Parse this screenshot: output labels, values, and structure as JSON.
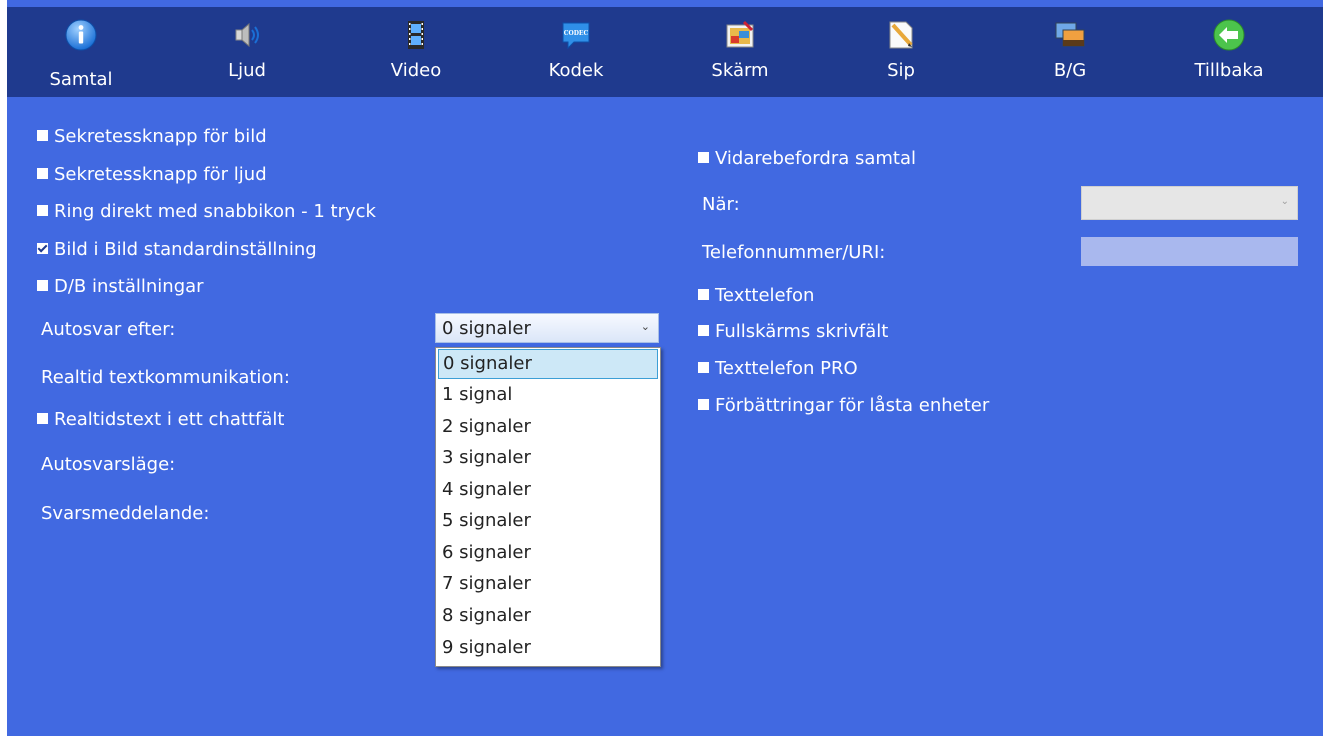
{
  "toolbar": {
    "items": [
      {
        "label": "Samtal",
        "icon": "info-icon"
      },
      {
        "label": "Ljud",
        "icon": "speaker-icon"
      },
      {
        "label": "Video",
        "icon": "film-icon"
      },
      {
        "label": "Kodek",
        "icon": "codec-icon",
        "icon_text": "CODEC"
      },
      {
        "label": "Skärm",
        "icon": "screen-icon"
      },
      {
        "label": "Sip",
        "icon": "notepad-pencil-icon"
      },
      {
        "label": "B/G",
        "icon": "background-image-icon"
      },
      {
        "label": "Tillbaka",
        "icon": "back-arrow-icon"
      }
    ]
  },
  "left": {
    "checkboxes": [
      {
        "label": "Sekretessknapp för bild",
        "checked": false
      },
      {
        "label": "Sekretessknapp för ljud",
        "checked": false
      },
      {
        "label": "Ring direkt med snabbikon - 1 tryck",
        "checked": false
      },
      {
        "label": "Bild i Bild standardinställning",
        "checked": true
      },
      {
        "label": "D/B inställningar",
        "checked": false
      }
    ],
    "autosvar_label": "Autosvar efter:",
    "autosvar_value": "0 signaler",
    "realtid_label": "Realtid textkommunikation:",
    "realtidstext_checkbox": {
      "label": "Realtidstext i ett chattfält",
      "checked": false
    },
    "autosvarslage_label": "Autosvarsläge:",
    "svarsmeddelande_label": "Svarsmeddelande:"
  },
  "dropdown": {
    "options": [
      "0 signaler",
      "1 signal",
      "2 signaler",
      "3 signaler",
      "4 signaler",
      "5 signaler",
      "6 signaler",
      "7 signaler",
      "8 signaler",
      "9 signaler"
    ],
    "selected_index": 0
  },
  "right": {
    "vidarebefordra": {
      "label": "Vidarebefordra samtal",
      "checked": false
    },
    "nar_label": "När:",
    "nar_value": "",
    "telefon_label": "Telefonnummer/URI:",
    "telefon_value": "",
    "checkboxes": [
      {
        "label": "Texttelefon",
        "checked": false
      },
      {
        "label": "Fullskärms skrivfält",
        "checked": false
      },
      {
        "label": "Texttelefon PRO",
        "checked": false
      },
      {
        "label": "Förbättringar för låsta enheter",
        "checked": false
      }
    ]
  },
  "colors": {
    "background": "#4169e1",
    "toolbar": "#1f3a8e",
    "text": "#ffffff"
  }
}
